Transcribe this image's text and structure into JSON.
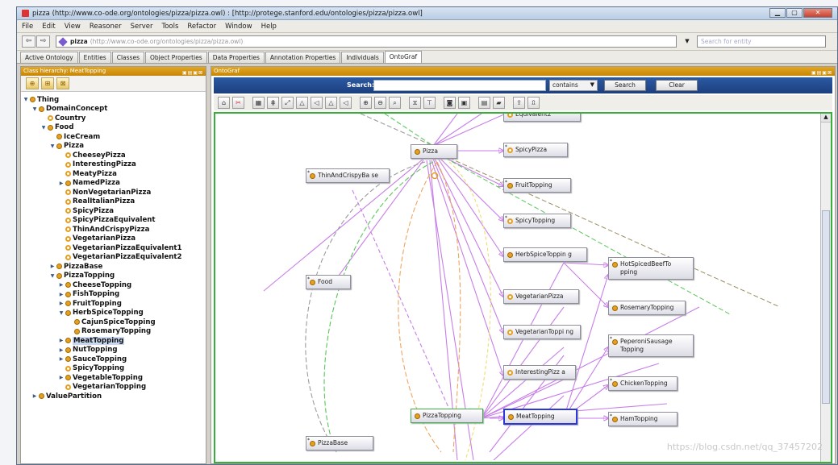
{
  "window": {
    "title": "pizza (http://www.co-ode.org/ontologies/pizza/pizza.owl)  : [http://protege.stanford.edu/ontologies/pizza/pizza.owl]"
  },
  "menu": [
    "File",
    "Edit",
    "View",
    "Reasoner",
    "Server",
    "Tools",
    "Refactor",
    "Window",
    "Help"
  ],
  "address": {
    "name": "pizza",
    "url": "(http://www.co-ode.org/ontologies/pizza/pizza.owl)",
    "search_placeholder": "Search for entity"
  },
  "tabs": [
    "Active Ontology",
    "Entities",
    "Classes",
    "Object Properties",
    "Data Properties",
    "Annotation Properties",
    "Individuals",
    "OntoGraf"
  ],
  "active_tab": "OntoGraf",
  "left_panel": {
    "header": "Class hierarchy: MeatTopping",
    "header_buttons": "▣▤▣⊠",
    "tree": [
      {
        "label": "Thing",
        "level": 0,
        "exp": "▼",
        "ring": false
      },
      {
        "label": "DomainConcept",
        "level": 1,
        "exp": "▼",
        "ring": false
      },
      {
        "label": "Country",
        "level": 2,
        "exp": "",
        "ring": true
      },
      {
        "label": "Food",
        "level": 2,
        "exp": "▼",
        "ring": false
      },
      {
        "label": "IceCream",
        "level": 3,
        "exp": "",
        "ring": false
      },
      {
        "label": "Pizza",
        "level": 3,
        "exp": "▼",
        "ring": false
      },
      {
        "label": "CheeseyPizza",
        "level": 4,
        "exp": "",
        "ring": true
      },
      {
        "label": "InterestingPizza",
        "level": 4,
        "exp": "",
        "ring": true
      },
      {
        "label": "MeatyPizza",
        "level": 4,
        "exp": "",
        "ring": true
      },
      {
        "label": "NamedPizza",
        "level": 4,
        "exp": "▶",
        "ring": false
      },
      {
        "label": "NonVegetarianPizza",
        "level": 4,
        "exp": "",
        "ring": true
      },
      {
        "label": "RealItalianPizza",
        "level": 4,
        "exp": "",
        "ring": true
      },
      {
        "label": "SpicyPizza",
        "level": 4,
        "exp": "",
        "ring": true
      },
      {
        "label": "SpicyPizzaEquivalent",
        "level": 4,
        "exp": "",
        "ring": true
      },
      {
        "label": "ThinAndCrispyPizza",
        "level": 4,
        "exp": "",
        "ring": true
      },
      {
        "label": "VegetarianPizza",
        "level": 4,
        "exp": "",
        "ring": true
      },
      {
        "label": "VegetarianPizzaEquivalent1",
        "level": 4,
        "exp": "",
        "ring": true
      },
      {
        "label": "VegetarianPizzaEquivalent2",
        "level": 4,
        "exp": "",
        "ring": true
      },
      {
        "label": "PizzaBase",
        "level": 3,
        "exp": "▶",
        "ring": false
      },
      {
        "label": "PizzaTopping",
        "level": 3,
        "exp": "▼",
        "ring": false
      },
      {
        "label": "CheeseTopping",
        "level": 4,
        "exp": "▶",
        "ring": false
      },
      {
        "label": "FishTopping",
        "level": 4,
        "exp": "▶",
        "ring": false
      },
      {
        "label": "FruitTopping",
        "level": 4,
        "exp": "▶",
        "ring": false
      },
      {
        "label": "HerbSpiceTopping",
        "level": 4,
        "exp": "▼",
        "ring": false
      },
      {
        "label": "CajunSpiceTopping",
        "level": 5,
        "exp": "",
        "ring": false
      },
      {
        "label": "RosemaryTopping",
        "level": 5,
        "exp": "",
        "ring": false
      },
      {
        "label": "MeatTopping",
        "level": 4,
        "exp": "▶",
        "ring": false,
        "selected": true
      },
      {
        "label": "NutTopping",
        "level": 4,
        "exp": "▶",
        "ring": false
      },
      {
        "label": "SauceTopping",
        "level": 4,
        "exp": "▶",
        "ring": false
      },
      {
        "label": "SpicyTopping",
        "level": 4,
        "exp": "",
        "ring": true
      },
      {
        "label": "VegetableTopping",
        "level": 4,
        "exp": "▶",
        "ring": false
      },
      {
        "label": "VegetarianTopping",
        "level": 4,
        "exp": "",
        "ring": true
      },
      {
        "label": "ValuePartition",
        "level": 1,
        "exp": "▶",
        "ring": false
      }
    ]
  },
  "right_panel": {
    "header": "OntoGraf",
    "header_buttons": "▣▤▣⊠",
    "search_label": "Search:",
    "search_value": "",
    "search_mode": "contains",
    "search_button": "Search",
    "clear_button": "Clear"
  },
  "graph_nodes": [
    {
      "label": "Equivalent2",
      "ring": true,
      "star": false
    },
    {
      "label": "Pizza",
      "ring": false,
      "star": false
    },
    {
      "label": "SpicyPizza",
      "ring": true,
      "star": true
    },
    {
      "label": "ThinAndCrispyBa se",
      "ring": false,
      "star": true
    },
    {
      "label": "FruitTopping",
      "ring": false,
      "star": true
    },
    {
      "label": "SpicyTopping",
      "ring": true,
      "star": true
    },
    {
      "label": "HerbSpiceToppin g",
      "ring": false,
      "star": false
    },
    {
      "label": "HotSpicedBeefTo pping",
      "ring": false,
      "star": true
    },
    {
      "label": "Food",
      "ring": false,
      "star": true
    },
    {
      "label": "VegetarianPizza",
      "ring": true,
      "star": false
    },
    {
      "label": "RosemaryTopping",
      "ring": false,
      "star": false
    },
    {
      "label": "VegetarianToppi ng",
      "ring": true,
      "star": false
    },
    {
      "label": "PeperoniSausage Topping",
      "ring": false,
      "star": true
    },
    {
      "label": "InterestingPizz a",
      "ring": true,
      "star": false
    },
    {
      "label": "ChickenTopping",
      "ring": false,
      "star": true
    },
    {
      "label": "PizzaTopping",
      "ring": false,
      "star": false
    },
    {
      "label": "MeatTopping",
      "ring": false,
      "star": false
    },
    {
      "label": "HamTopping",
      "ring": false,
      "star": true
    },
    {
      "label": "PizzaBase",
      "ring": false,
      "star": true
    }
  ],
  "watermark": "https://blog.csdn.net/qq_37457202",
  "colors": {
    "panel_header": "#d99a14",
    "search_bar": "#244d94",
    "canvas_border": "#36b038",
    "node_dot": "#e5a021",
    "edge_purple": "#c77ee8",
    "edge_green": "#59c559",
    "edge_orange": "#f0a55c"
  }
}
